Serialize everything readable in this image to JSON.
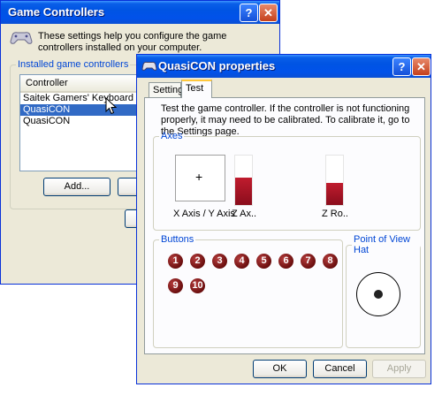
{
  "gc_window": {
    "title": "Game Controllers",
    "description": "These settings help you configure the game controllers installed on your computer.",
    "group_label": "Installed game controllers",
    "column_header": "Controller",
    "rows": [
      {
        "label": "Saitek Gamers' Keyboard",
        "selected": false
      },
      {
        "label": "QuasiCON",
        "selected": true
      },
      {
        "label": "QuasiCON",
        "selected": false
      }
    ],
    "add_label": "Add..."
  },
  "qc_window": {
    "title": "QuasiCON properties",
    "tabs": [
      "Settings",
      "Test"
    ],
    "active_tab": "Test",
    "intro": "Test the game controller.  If the controller is not functioning properly, it may need to be calibrated.  To calibrate it, go to the Settings page.",
    "axes": {
      "legend": "Axes",
      "xy_label": "X Axis / Y Axis",
      "z_label": "Z Ax..",
      "zr_label": "Z Ro..",
      "z_level": 0.55,
      "zr_level": 0.45
    },
    "buttons": {
      "legend": "Buttons",
      "labels": [
        "1",
        "2",
        "3",
        "4",
        "5",
        "6",
        "7",
        "8",
        "9",
        "10"
      ]
    },
    "pov": {
      "legend": "Point of View Hat"
    },
    "ok_label": "OK",
    "cancel_label": "Cancel",
    "apply_label": "Apply"
  },
  "colors": {
    "title_blue": "#0054e3",
    "selection": "#316ac5",
    "button_red": "#8a0d1c"
  }
}
